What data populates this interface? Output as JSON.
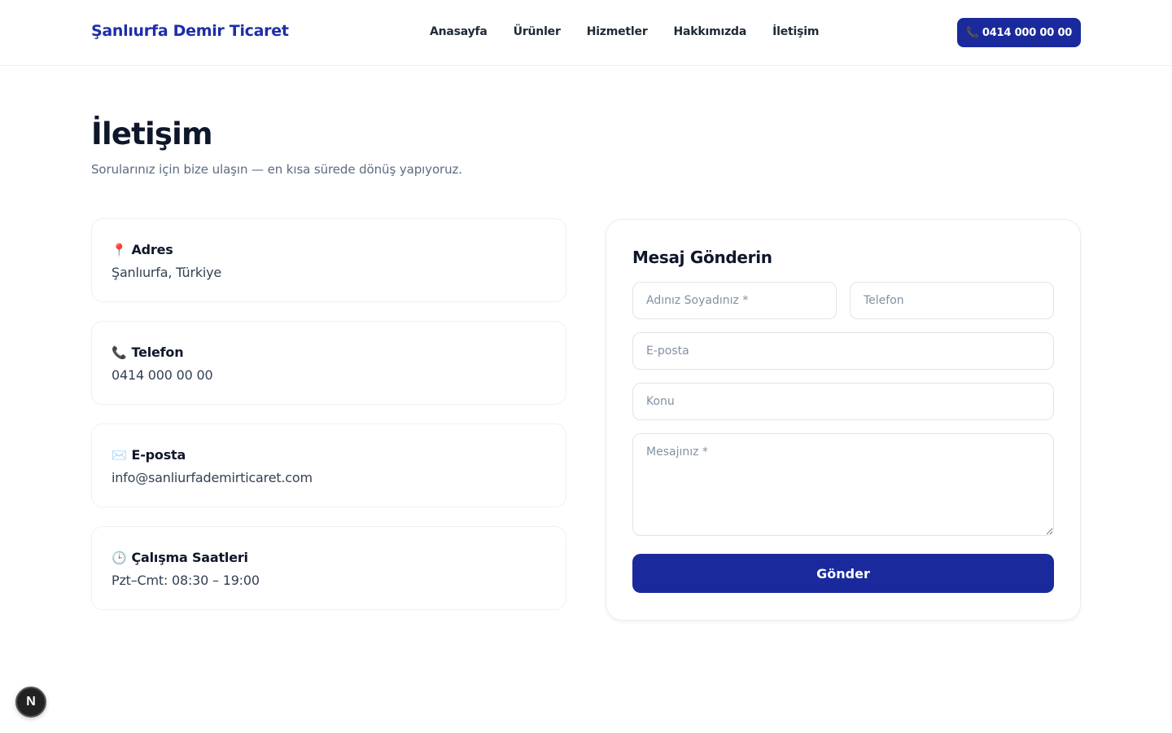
{
  "header": {
    "brand": "Şanlıurfa Demir Ticaret",
    "nav": [
      "Anasayfa",
      "Ürünler",
      "Hizmetler",
      "Hakkımızda",
      "İletişim"
    ],
    "call_button": {
      "icon": "phone-icon",
      "label": "0414 000 00 00"
    }
  },
  "page": {
    "title": "İletişim",
    "subtitle": "Sorularınız için bize ulaşın — en kısa sürede dönüş yapıyoruz."
  },
  "info_cards": [
    {
      "icon": "pin-icon",
      "title": "Adres",
      "value": "Şanlıurfa, Türkiye"
    },
    {
      "icon": "phone-icon",
      "title": "Telefon",
      "value": "0414 000 00 00"
    },
    {
      "icon": "envelope-icon",
      "title": "E-posta",
      "value": "info@sanliurfademirticaret.com"
    },
    {
      "icon": "clock-icon",
      "title": "Çalışma Saatleri",
      "value": "Pzt–Cmt: 08:30 – 19:00"
    }
  ],
  "form": {
    "title": "Mesaj Gönderin",
    "name_placeholder": "Adınız Soyadınız *",
    "phone_placeholder": "Telefon",
    "email_placeholder": "E-posta",
    "subject_placeholder": "Konu",
    "message_placeholder": "Mesajınız *",
    "submit_label": "Gönder"
  },
  "badge": {
    "label": "N"
  }
}
